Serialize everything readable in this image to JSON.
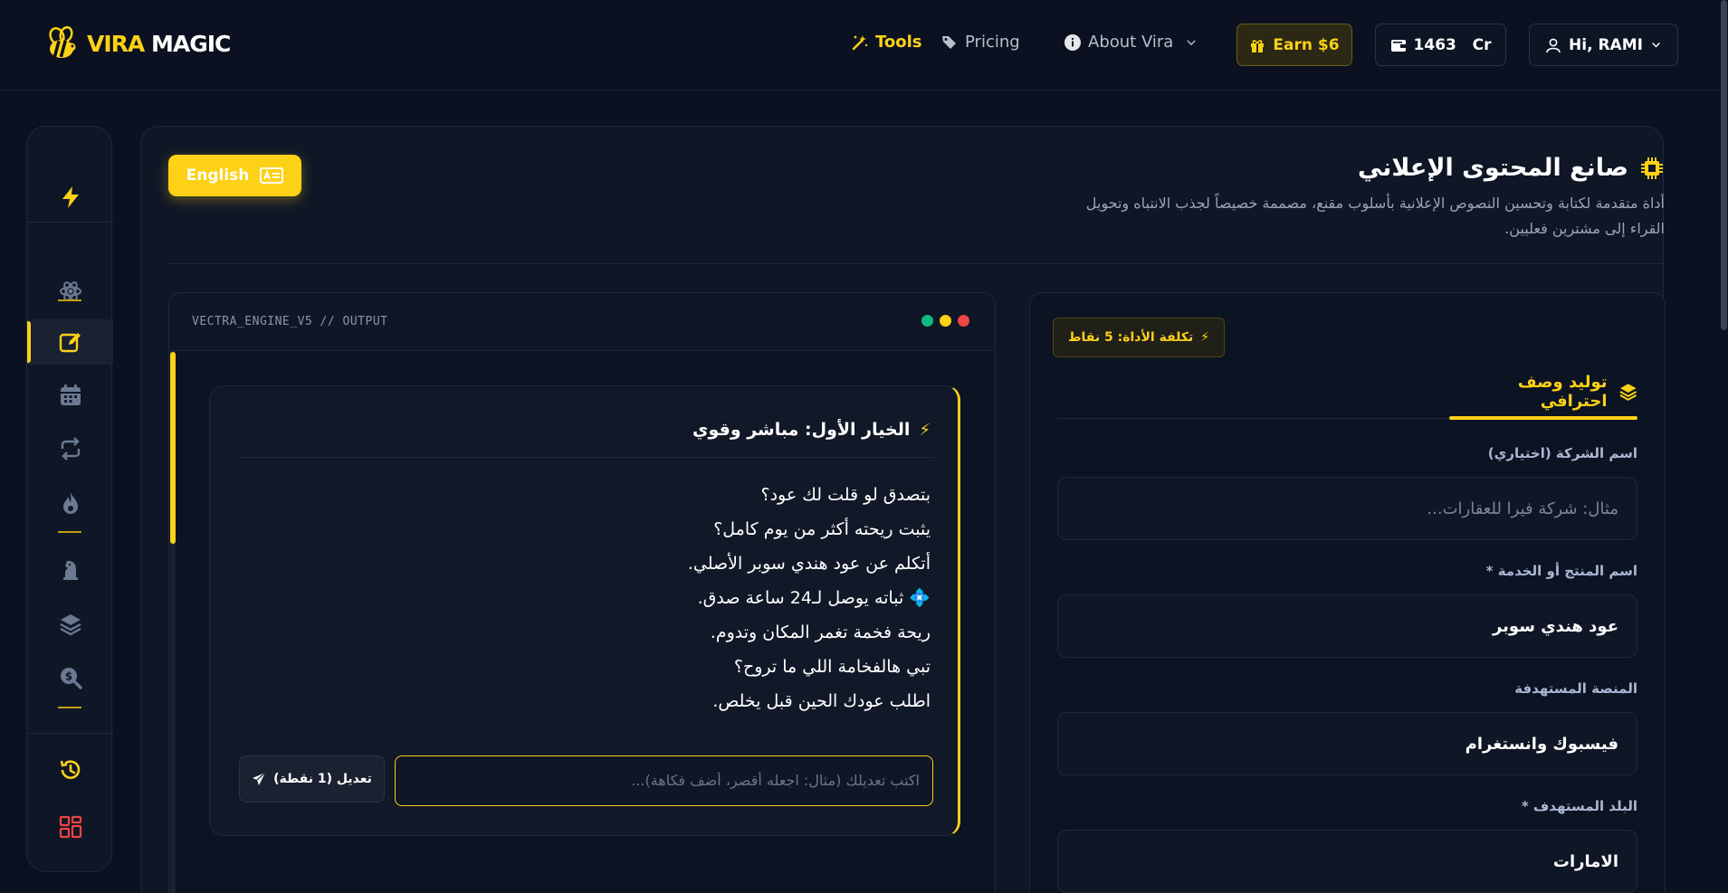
{
  "brand": {
    "part1": "VIRA",
    "part2": "MAGIC"
  },
  "nav": {
    "tools": "Tools",
    "pricing": "Pricing",
    "about": "About Vira",
    "earn": "Earn $6",
    "credits": "1463   Cr",
    "user": "Hi, RAMI"
  },
  "sidebar": {
    "items": [
      {
        "icon": "lightning-icon"
      },
      {
        "icon": "atom-icon"
      },
      {
        "icon": "edit-icon"
      },
      {
        "icon": "calendar-icon"
      },
      {
        "icon": "repeat-icon"
      },
      {
        "icon": "fire-icon"
      },
      {
        "icon": "chess-knight-icon"
      },
      {
        "icon": "layers-icon"
      },
      {
        "icon": "search-dollar-icon"
      },
      {
        "icon": "history-icon"
      },
      {
        "icon": "grid-icon"
      }
    ]
  },
  "header": {
    "lang_button": "English",
    "title": "صانع المحتوى الإعلاني",
    "description": "أداة متقدمة لكتابة وتحسين النصوص الإعلانية بأسلوب مقنع، مصممة خصيصاً لجذب الانتباه وتحويل القراء إلى مشترين فعليين."
  },
  "output": {
    "label": "VECTRA_ENGINE_V5 // OUTPUT",
    "option_title": "الخيار الأول: مباشر وقوي",
    "lines": [
      "بتصدق لو قلت لك عود؟",
      "يثبت ريحته أكثر من يوم كامل؟",
      "أتكلم عن عود هندي سوبر الأصلي.",
      "💠 ثباته يوصل لـ24 ساعة صدق.",
      "ريحة فخمة تغمر المكان وتدوم.",
      "تبي هالفخامة اللي ما تروح؟",
      "اطلب عودك الحين قبل يخلص."
    ],
    "edit_placeholder": "اكتب تعديلك (مثال: اجعله أقصر، أضف فكاهة)...",
    "edit_button": "تعديل (1 نقطة)"
  },
  "form": {
    "cost_badge": "تكلفة الأداة: 5 نقاط",
    "tab": "توليد وصف احترافي",
    "company_label": "اسم الشركة (اختياري)",
    "company_placeholder": "مثال: شركة فيرا للعقارات...",
    "product_label": "اسم المنتج أو الخدمة *",
    "product_value": "عود هندي سوبر",
    "platform_label": "المنصة المستهدفة",
    "platform_value": "فيسبوك وانستغرام",
    "country_label": "البلد المستهدف *",
    "country_value": "الامارات"
  },
  "colors": {
    "accent": "#fcd116",
    "background": "#0b1120",
    "panel": "#0f1626",
    "dot_green": "#10b981",
    "dot_yellow": "#fcd116",
    "dot_red": "#ef4444"
  }
}
